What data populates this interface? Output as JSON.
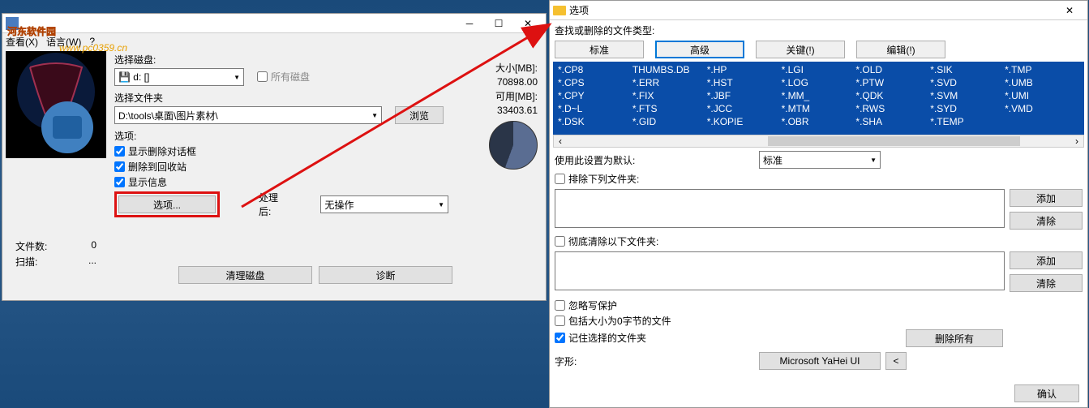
{
  "left": {
    "menu": {
      "view": "查看(X)",
      "lang": "语言(W)",
      "help": "?"
    },
    "select_disk_label": "选择磁盘:",
    "disk_value": "💾 d: []",
    "all_disks": "所有磁盘",
    "select_folder_label": "选择文件夹",
    "folder_value": "D:\\tools\\桌面\\图片素材\\",
    "browse": "浏览",
    "options_label": "选项:",
    "chk_show_delete_dialog": "显示删除对话框",
    "chk_recycle_bin": "删除到回收站",
    "chk_show_info": "显示信息",
    "options_btn": "选项...",
    "after_label": "处理后:",
    "after_value": "无操作",
    "size_label": "大小[MB]:",
    "size_val": "70898.00",
    "avail_label": "可用[MB]:",
    "avail_val": "33403.61",
    "filecount_label": "文件数:",
    "filecount_val": "0",
    "scan_label": "扫描:",
    "scan_val": "...",
    "clean_disk": "清理磁盘",
    "diagnose": "诊断"
  },
  "right": {
    "title": "选项",
    "find_types_label": "查找或删除的文件类型:",
    "tabs": {
      "std": "标准",
      "adv": "高级",
      "key": "关键(!)",
      "edit": "编辑(!)"
    },
    "exts": [
      "*.CP8",
      "THUMBS.DB",
      "*.HP",
      "*.LGI",
      "*.OLD",
      "*.SIK",
      "*.TMP",
      "*.CPS",
      "*.ERR",
      "*.HST",
      "*.LOG",
      "*.PTW",
      "*.SVD",
      "*.UMB",
      "*.CPY",
      "*.FIX",
      "*.JBF",
      "*.MM_",
      "*.QDK",
      "*.SVM",
      "*.UMI",
      "*.D~L",
      "*.FTS",
      "*.JCC",
      "*.MTM",
      "*.RWS",
      "*.SYD",
      "*.VMD",
      "*.DSK",
      "*.GID",
      "*.KOPIE",
      "*.OBR",
      "*.SHA",
      "*.TEMP",
      ""
    ],
    "default_label": "使用此设置为默认:",
    "default_val": "标准",
    "exclude_folders": "排除下列文件夹:",
    "add": "添加",
    "clear": "清除",
    "purge_folders": "彻底清除以下文件夹:",
    "ignore_readonly": "忽略写保护",
    "include_zero": "包括大小为0字节的文件",
    "remember": "记住选择的文件夹",
    "delete_all": "删除所有",
    "font_label": "字形:",
    "font_val": "Microsoft YaHei UI",
    "font_less": "<",
    "ok": "确认"
  }
}
